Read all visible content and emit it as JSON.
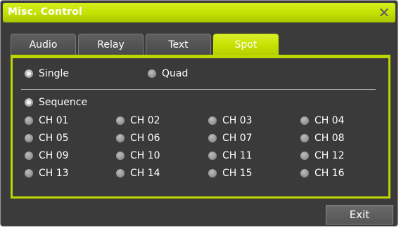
{
  "window": {
    "title": "Misc. Control",
    "close_glyph": "✕"
  },
  "tabs": [
    {
      "label": "Audio",
      "active": false
    },
    {
      "label": "Relay",
      "active": false
    },
    {
      "label": "Text",
      "active": false
    },
    {
      "label": "Spot",
      "active": true
    }
  ],
  "spot": {
    "mode_options": [
      {
        "label": "Single",
        "selected": true
      },
      {
        "label": "Quad",
        "selected": false
      }
    ],
    "sequence": {
      "label": "Sequence",
      "selected": true
    },
    "channels": [
      "CH 01",
      "CH 02",
      "CH 03",
      "CH 04",
      "CH 05",
      "CH 06",
      "CH 07",
      "CH 08",
      "CH 09",
      "CH 10",
      "CH 11",
      "CH 12",
      "CH 13",
      "CH 14",
      "CH 15",
      "CH 16"
    ]
  },
  "footer": {
    "exit_label": "Exit"
  },
  "colors": {
    "accent": "#c4df00",
    "background": "#3b3b3b"
  }
}
